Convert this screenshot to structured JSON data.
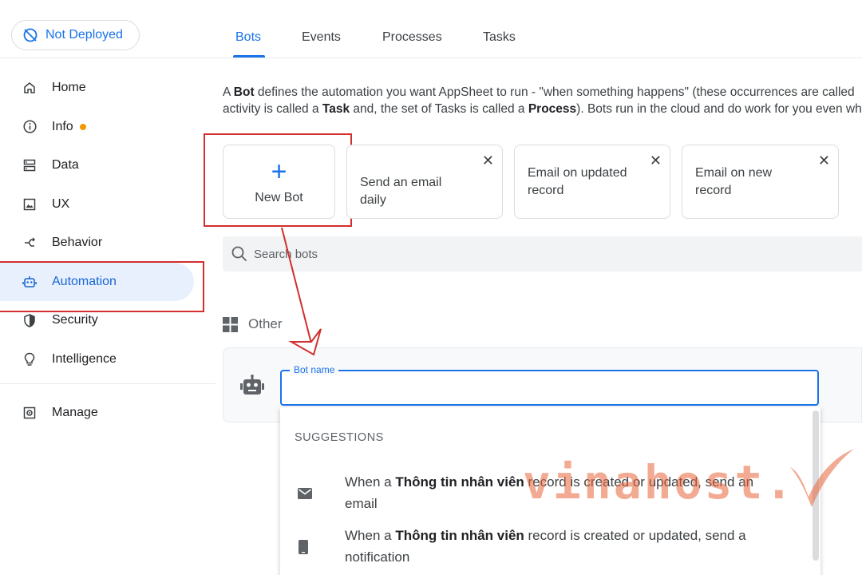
{
  "deploy_status": "Not Deployed",
  "sidebar": {
    "items": [
      {
        "label": "Home",
        "icon": "home-icon"
      },
      {
        "label": "Info",
        "icon": "info-icon"
      },
      {
        "label": "Data",
        "icon": "data-icon"
      },
      {
        "label": "UX",
        "icon": "ux-icon"
      },
      {
        "label": "Behavior",
        "icon": "behavior-icon"
      },
      {
        "label": "Automation",
        "icon": "robot-icon"
      },
      {
        "label": "Security",
        "icon": "shield-icon"
      },
      {
        "label": "Intelligence",
        "icon": "lightbulb-icon"
      }
    ],
    "manage": "Manage"
  },
  "tabs": [
    "Bots",
    "Events",
    "Processes",
    "Tasks"
  ],
  "description": {
    "p1": "A ",
    "bot": "Bot",
    "p2": " defines the automation you want AppSheet to run - \"when something happens\" (these occurrences are called",
    "p3": "activity is called a ",
    "task": "Task",
    "p4": " and, the set of Tasks is called a ",
    "process": "Process",
    "p5": "). Bots run in the cloud and do work for you even wh"
  },
  "new_bot_label": "New Bot",
  "templates": [
    {
      "line1": "Send an email daily",
      "line2": ""
    },
    {
      "line1": "Email on updated",
      "line2": "record"
    },
    {
      "line1": "Email on new",
      "line2": "record"
    }
  ],
  "search": {
    "placeholder": "Search bots"
  },
  "other_label": "Other",
  "bot_name_label": "Bot name",
  "bot_name_value": "",
  "suggestions": {
    "header": "SUGGESTIONS",
    "items": [
      {
        "pre": "When a ",
        "table": "Thông tin nhân viên",
        "post": " record is created or updated, send an",
        "line2": "email",
        "icon": "email-icon"
      },
      {
        "pre": "When a ",
        "table": "Thông tin nhân viên",
        "post": " record is created or updated, send a",
        "line2": "notification",
        "icon": "phone-icon"
      }
    ]
  },
  "watermark": "vinahost.",
  "colors": {
    "accent": "#1a73e8",
    "highlight": "#d32f2f",
    "dot": "#f29900",
    "watermark": "#e8643a"
  }
}
